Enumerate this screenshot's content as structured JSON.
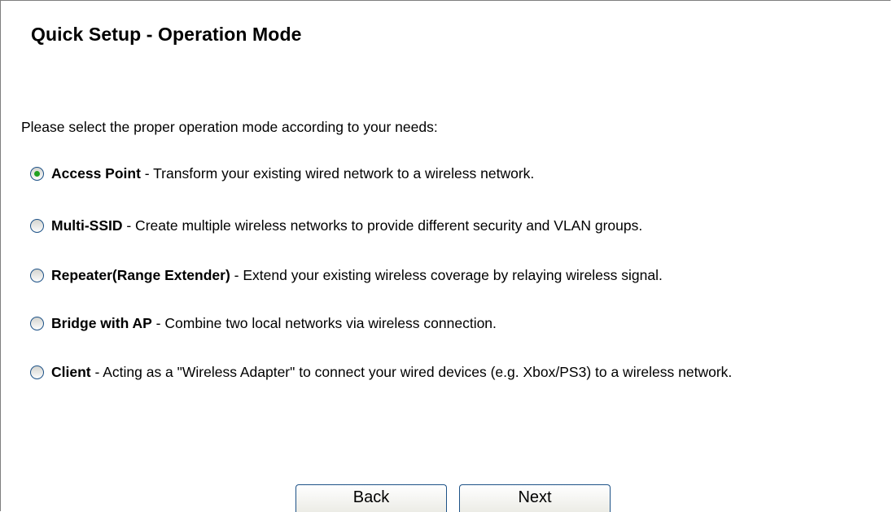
{
  "page": {
    "title": "Quick Setup - Operation Mode",
    "intro": "Please select the proper operation mode according to your needs:"
  },
  "options": [
    {
      "name": "Access Point",
      "desc": " - Transform your existing wired network to a wireless network.",
      "checked": true
    },
    {
      "name": "Multi-SSID",
      "desc": " - Create multiple wireless networks to provide different security and VLAN groups.",
      "checked": false
    },
    {
      "name": "Repeater(Range Extender)",
      "desc": " - Extend your existing wireless coverage by relaying wireless signal.",
      "checked": false
    },
    {
      "name": "Bridge with AP",
      "desc": " - Combine two local networks via wireless connection.",
      "checked": false
    },
    {
      "name": "Client",
      "desc": " - Acting as a \"Wireless Adapter\" to connect your wired devices (e.g. Xbox/PS3) to a wireless network.",
      "checked": false
    }
  ],
  "buttons": {
    "back": "Back",
    "next": "Next"
  },
  "colors": {
    "radio_border": "#1d5287",
    "radio_dot": "#21a121",
    "panel_border": "#7f7f7f"
  }
}
